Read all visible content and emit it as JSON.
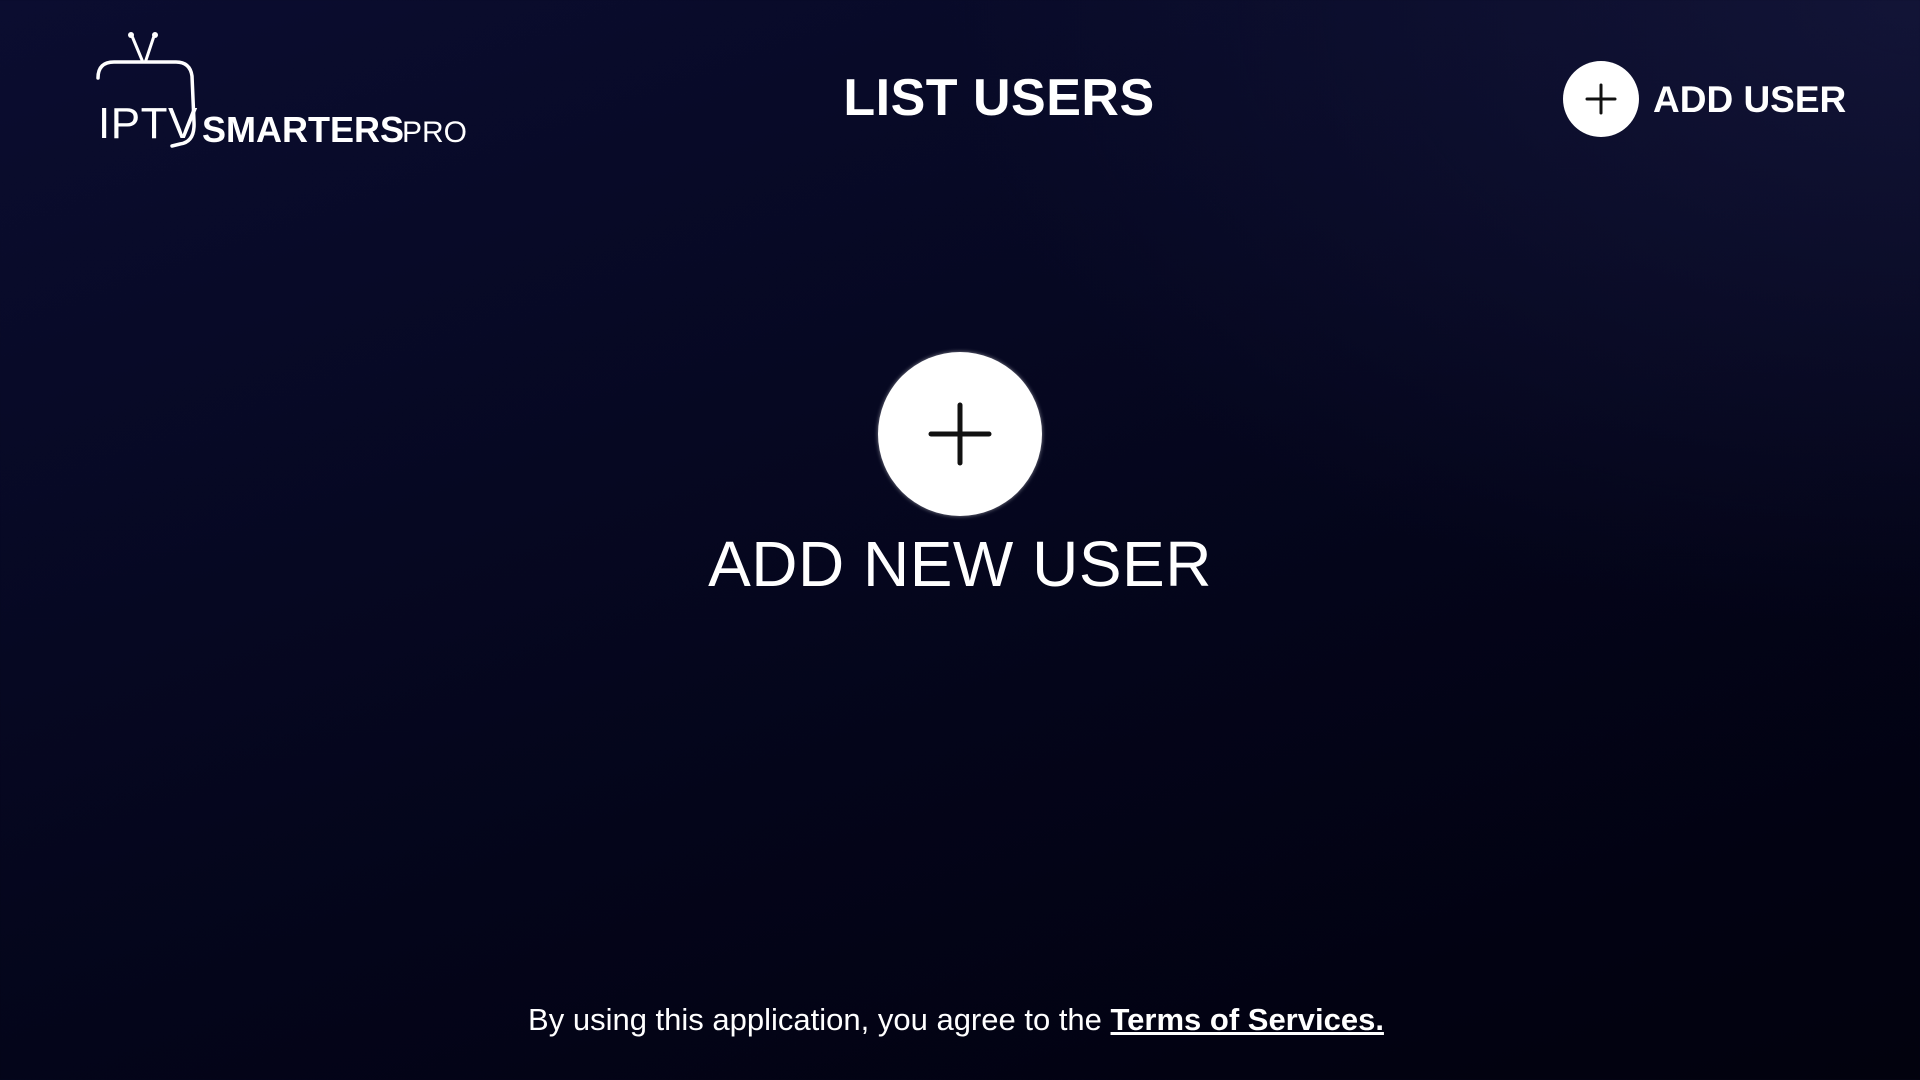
{
  "app": {
    "logo_iptv": "IPTV",
    "logo_smarters": "SMARTERS",
    "logo_pro": "PRO"
  },
  "header": {
    "title": "LIST USERS",
    "add_user_label": "ADD USER"
  },
  "main": {
    "add_new_user_label": "ADD NEW USER"
  },
  "footer": {
    "agreement_text": "By using this application, you agree to the ",
    "terms_link": "Terms of Services."
  },
  "icons": {
    "add_user": "plus-icon",
    "add_new_user": "plus-icon",
    "logo": "tv-icon"
  },
  "colors": {
    "background_top": "#0b0d30",
    "background_bottom": "#02020e",
    "text": "#ffffff",
    "button_circle": "#ffffff",
    "icon": "#111111"
  }
}
